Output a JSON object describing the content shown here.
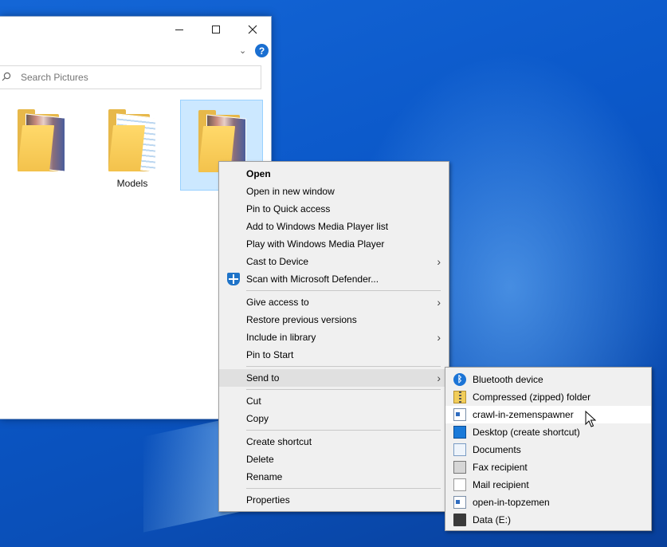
{
  "explorer": {
    "search_placeholder": "Search Pictures",
    "help_label": "?",
    "folders": [
      {
        "label": ""
      },
      {
        "label": "Models"
      },
      {
        "label": ""
      }
    ]
  },
  "context_menu": {
    "items": {
      "open": "Open",
      "open_new_window": "Open in new window",
      "pin_quick_access": "Pin to Quick access",
      "add_wmp_list": "Add to Windows Media Player list",
      "play_wmp": "Play with Windows Media Player",
      "cast_to_device": "Cast to Device",
      "scan_defender": "Scan with Microsoft Defender...",
      "give_access": "Give access to",
      "restore_versions": "Restore previous versions",
      "include_library": "Include in library",
      "pin_start": "Pin to Start",
      "send_to": "Send to",
      "cut": "Cut",
      "copy": "Copy",
      "create_shortcut": "Create shortcut",
      "delete": "Delete",
      "rename": "Rename",
      "properties": "Properties"
    }
  },
  "send_to_menu": {
    "items": [
      {
        "label": "Bluetooth device",
        "icon": "bluetooth-icon"
      },
      {
        "label": "Compressed (zipped) folder",
        "icon": "zip-folder-icon"
      },
      {
        "label": "crawl-in-zemenspawner",
        "icon": "executable-icon"
      },
      {
        "label": "Desktop (create shortcut)",
        "icon": "desktop-icon"
      },
      {
        "label": "Documents",
        "icon": "documents-icon"
      },
      {
        "label": "Fax recipient",
        "icon": "fax-icon"
      },
      {
        "label": "Mail recipient",
        "icon": "mail-icon"
      },
      {
        "label": "open-in-topzemen",
        "icon": "executable-icon"
      },
      {
        "label": "Data (E:)",
        "icon": "drive-icon"
      }
    ]
  },
  "colors": {
    "desktop_blue": "#0b58c9",
    "menu_bg": "#f0f0f0",
    "selection": "#cce8ff",
    "accent": "#1a6fd1"
  }
}
